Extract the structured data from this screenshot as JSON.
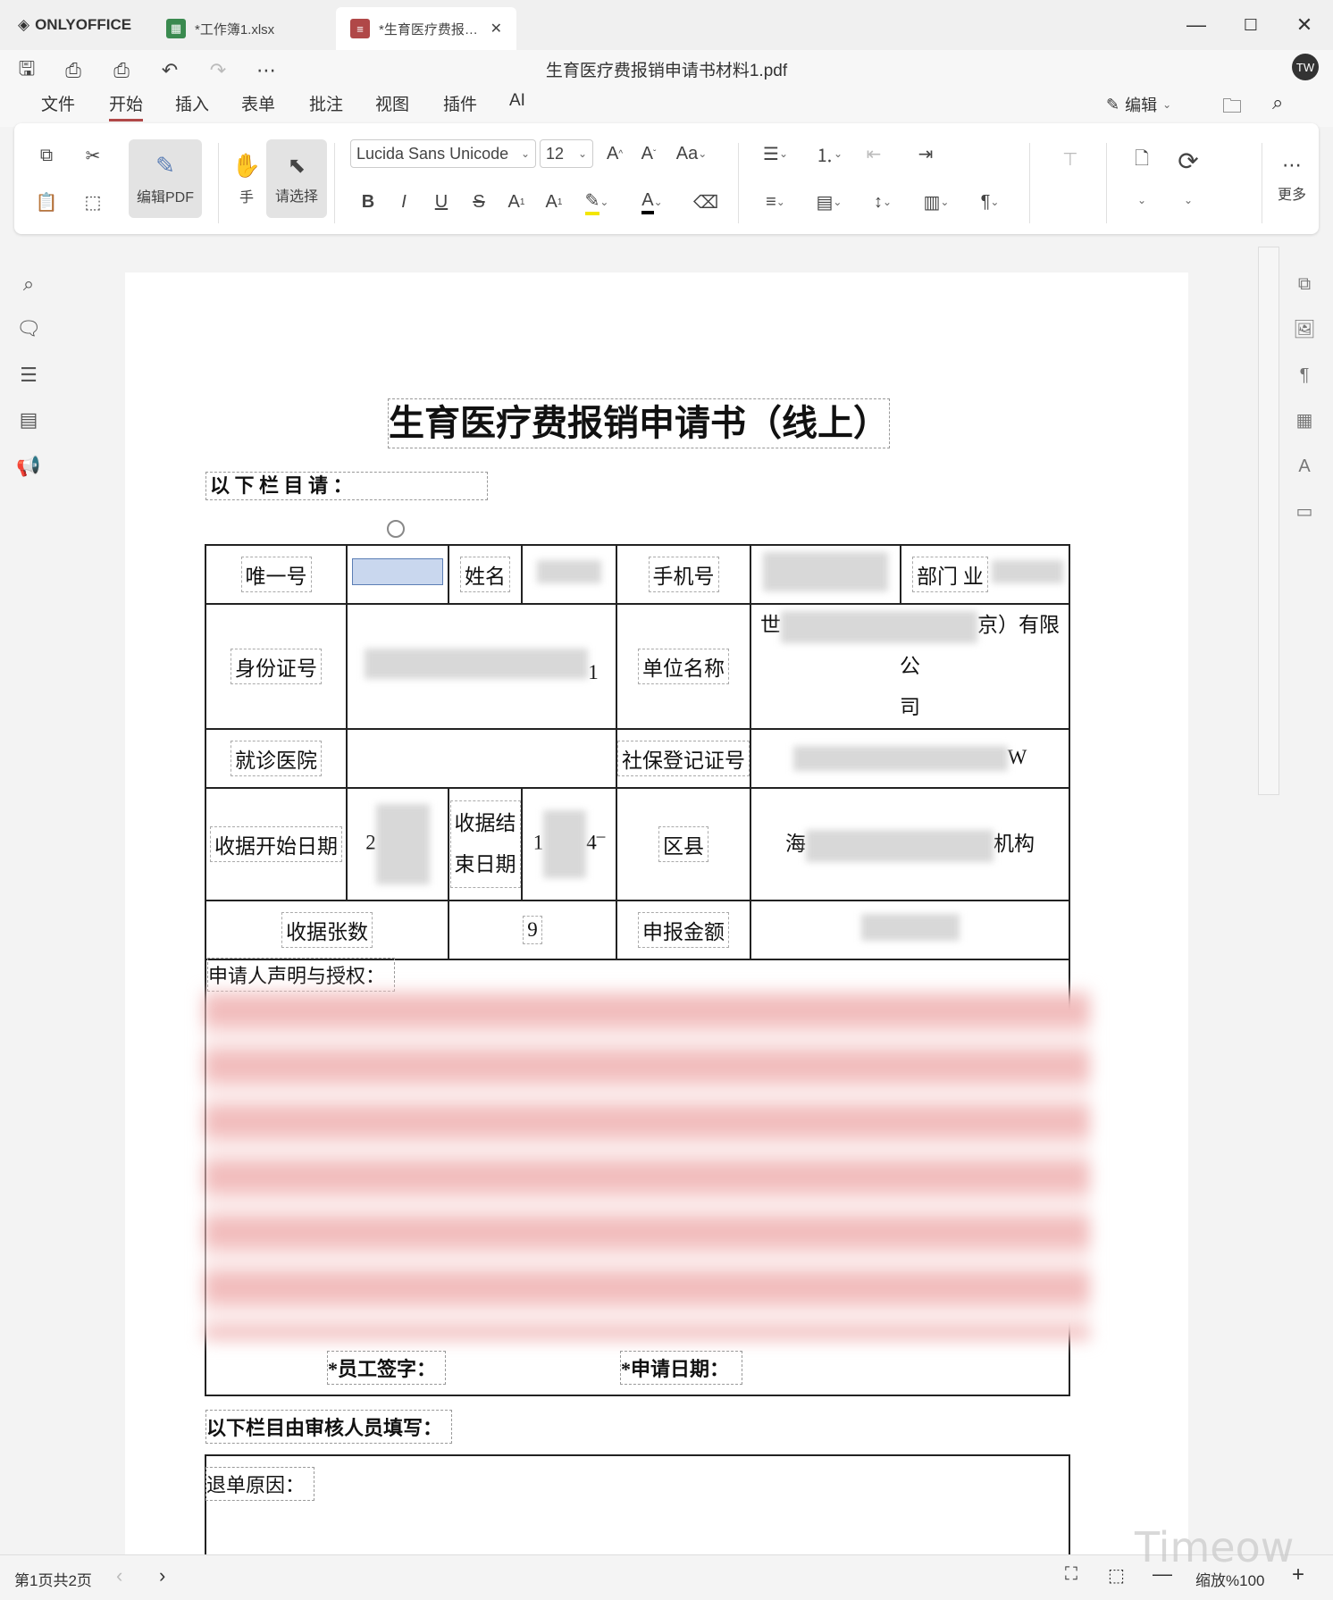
{
  "app": {
    "brand": "ONLYOFFICE",
    "tabs": [
      {
        "label": "*工作簿1.xlsx",
        "icon": "spreadsheet-icon",
        "color": "#3a8a4f"
      },
      {
        "label": "*生育医疗费报…",
        "icon": "pdf-icon",
        "color": "#b04848"
      }
    ],
    "window_controls": [
      "—",
      "☐",
      "✕"
    ]
  },
  "header": {
    "document_title": "生育医疗费报销申请书材料1.pdf",
    "avatar": "TW",
    "menus": [
      "文件",
      "开始",
      "插入",
      "表单",
      "批注",
      "视图",
      "插件",
      "AI"
    ],
    "active_menu": "开始",
    "edit_label": "编辑"
  },
  "toolbar": {
    "edit_pdf": "编辑PDF",
    "hand": "手",
    "select": "请选择",
    "font_name": "Lucida Sans Unicode",
    "font_size": "12",
    "more": "更多"
  },
  "document": {
    "title": "生育医疗费报销申请书（线上）",
    "intro": "以 下 栏 目 请 ：",
    "labels": {
      "unique_id": "唯一号",
      "name": "姓名",
      "phone": "手机号",
      "dept": "部门 业",
      "id_card": "身份证号",
      "id_card_end": "1",
      "unit_name": "单位名称",
      "unit_prefix": "世",
      "unit_suffix": "京）有限公",
      "unit_suffix2": "司",
      "hospital": "就诊医院",
      "social_reg": "社保登记证号",
      "social_suffix": "W",
      "receipt_start": "收据开始日期",
      "receipt_start_val": "2",
      "receipt_end": "收据结束日期",
      "receipt_end_line1": "收据结",
      "receipt_end_line2": "束日期",
      "receipt_end_val_top": "–",
      "receipt_end_val_left": "1",
      "receipt_end_val_right": "4",
      "district": "区县",
      "district_prefix": "海",
      "district_suffix": "机构",
      "receipt_count": "收据张数",
      "receipt_count_val": "9",
      "amount": "申报金额",
      "declaration": "申请人声明与授权：",
      "signature": "*员工签字：",
      "apply_date": "*申请日期：",
      "reviewer": "以下栏目由审核人员填写：",
      "return_reason": "退单原因："
    }
  },
  "status": {
    "page_info": "第1页共2页",
    "zoom": "缩放%100",
    "watermark": "Timeow"
  }
}
